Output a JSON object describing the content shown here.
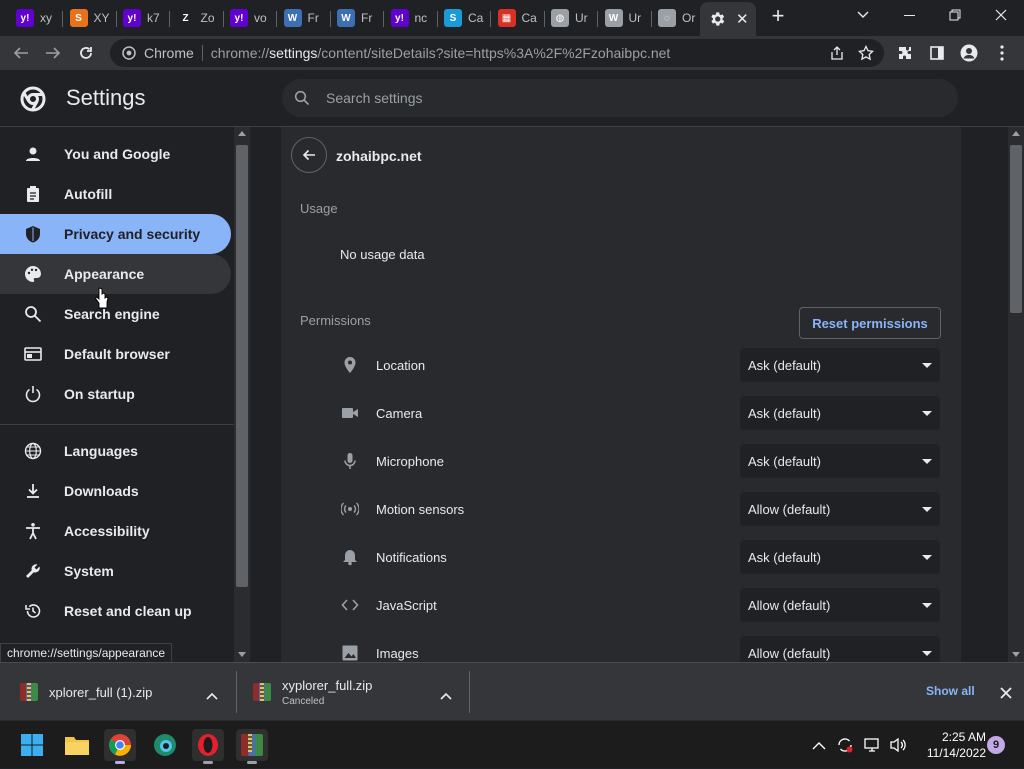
{
  "tabs": [
    {
      "title": "xy",
      "favicon": "yahoo-icon",
      "color": "#6001d2"
    },
    {
      "title": "XY",
      "favicon": "s-icon",
      "color": "#e8711c"
    },
    {
      "title": "k7",
      "favicon": "yahoo-icon",
      "color": "#6001d2"
    },
    {
      "title": "Zo",
      "favicon": "z-icon",
      "color": "#202124"
    },
    {
      "title": "vo",
      "favicon": "yahoo-icon",
      "color": "#6001d2"
    },
    {
      "title": "Fr",
      "favicon": "wordpress-icon",
      "color": "#3d6fb4"
    },
    {
      "title": "Fr",
      "favicon": "wordpress-icon",
      "color": "#3d6fb4"
    },
    {
      "title": "nc",
      "favicon": "yahoo-icon",
      "color": "#6001d2"
    },
    {
      "title": "Ca",
      "favicon": "s-icon",
      "color": "#1a9bd7"
    },
    {
      "title": "Ca",
      "favicon": "store-icon",
      "color": "#d93025"
    },
    {
      "title": "Ur",
      "favicon": "globe-icon",
      "color": "#9aa0a6"
    },
    {
      "title": "Ur",
      "favicon": "wordpress-icon",
      "color": "#9aa0a6"
    },
    {
      "title": "Or",
      "favicon": "loading-icon",
      "color": "#9aa0a6"
    }
  ],
  "toolbar": {
    "chip": "Chrome",
    "url_prefix": "chrome://",
    "url_host": "settings",
    "url_rest": "/content/siteDetails?site=https%3A%2F%2Fzohaibpc.net"
  },
  "header": {
    "title": "Settings",
    "search_placeholder": "Search settings"
  },
  "sidebar": {
    "items": [
      {
        "label": "You and Google",
        "icon": "person-icon"
      },
      {
        "label": "Autofill",
        "icon": "clipboard-icon"
      },
      {
        "label": "Privacy and security",
        "icon": "shield-icon"
      },
      {
        "label": "Appearance",
        "icon": "palette-icon"
      },
      {
        "label": "Search engine",
        "icon": "search-icon"
      },
      {
        "label": "Default browser",
        "icon": "browser-icon"
      },
      {
        "label": "On startup",
        "icon": "power-icon"
      },
      {
        "label": "Languages",
        "icon": "globe-icon"
      },
      {
        "label": "Downloads",
        "icon": "download-icon"
      },
      {
        "label": "Accessibility",
        "icon": "accessibility-icon"
      },
      {
        "label": "System",
        "icon": "wrench-icon"
      },
      {
        "label": "Reset and clean up",
        "icon": "history-icon"
      }
    ],
    "selected": "Privacy and security"
  },
  "main": {
    "site": "zohaibpc.net",
    "usage_heading": "Usage",
    "usage_value": "No usage data",
    "permissions_heading": "Permissions",
    "reset_label": "Reset permissions",
    "permissions": [
      {
        "label": "Location",
        "value": "Ask (default)",
        "icon": "location-icon"
      },
      {
        "label": "Camera",
        "value": "Ask (default)",
        "icon": "camera-icon"
      },
      {
        "label": "Microphone",
        "value": "Ask (default)",
        "icon": "microphone-icon"
      },
      {
        "label": "Motion sensors",
        "value": "Allow (default)",
        "icon": "sensors-icon"
      },
      {
        "label": "Notifications",
        "value": "Ask (default)",
        "icon": "bell-icon"
      },
      {
        "label": "JavaScript",
        "value": "Allow (default)",
        "icon": "code-icon"
      },
      {
        "label": "Images",
        "value": "Allow (default)",
        "icon": "image-icon"
      }
    ]
  },
  "status_url": "chrome://settings/appearance",
  "downloads": {
    "items": [
      {
        "name": "xplorer_full (1).zip",
        "status": ""
      },
      {
        "name": "xyplorer_full.zip",
        "status": "Canceled"
      }
    ],
    "show_all": "Show all"
  },
  "taskbar": {
    "time": "2:25 AM",
    "date": "11/14/2022",
    "notification_count": "9"
  }
}
